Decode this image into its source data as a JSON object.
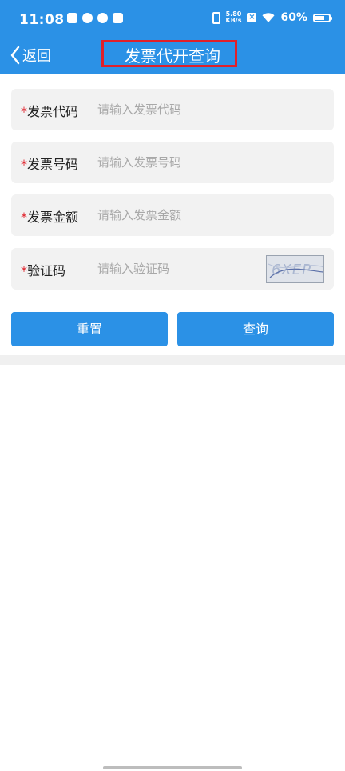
{
  "status_bar": {
    "time": "11:08",
    "net_speed_value": "5.80",
    "net_speed_unit": "KB/s",
    "battery_percent": "60%"
  },
  "appbar": {
    "back_label": "返回",
    "title": "发票代开查询"
  },
  "form": {
    "required_mark": "*",
    "fields": [
      {
        "label": "发票代码",
        "placeholder": "请输入发票代码",
        "value": ""
      },
      {
        "label": "发票号码",
        "placeholder": "请输入发票号码",
        "value": ""
      },
      {
        "label": "发票金额",
        "placeholder": "请输入发票金额",
        "value": ""
      },
      {
        "label": "验证码",
        "placeholder": "请输入验证码",
        "value": ""
      }
    ],
    "captcha_text": "6XEP"
  },
  "buttons": {
    "reset": "重置",
    "query": "查询"
  },
  "colors": {
    "primary": "#2b91e6",
    "required": "#e0202a",
    "field_bg": "#f2f2f2"
  }
}
